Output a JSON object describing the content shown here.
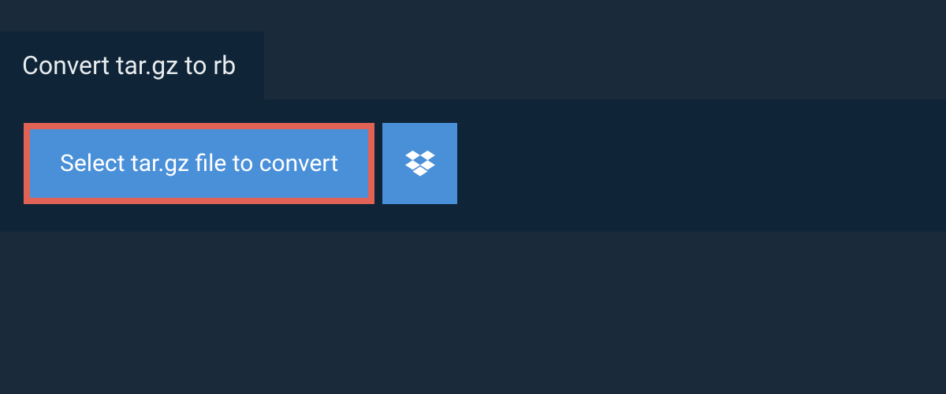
{
  "header": {
    "title": "Convert tar.gz to rb"
  },
  "upload": {
    "select_label": "Select tar.gz file to convert"
  },
  "colors": {
    "bg_outer": "#1a2a3a",
    "bg_panel": "#0f2537",
    "button_blue": "#4a90d9",
    "button_border": "#e06355",
    "text_light": "#e8ecef",
    "text_white": "#ffffff"
  }
}
